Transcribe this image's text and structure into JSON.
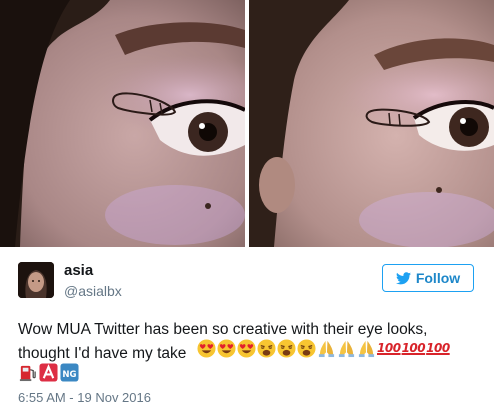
{
  "tweet": {
    "display_name": "asia",
    "handle": "@asialbx",
    "follow_label": "Follow",
    "text": "Wow MUA Twitter has been so creative with their eye looks, thought I'd have my take",
    "emoji_text": "😍😍😍😩😩😩🙏🙏🙏💯💯💯⛽🅰🆖",
    "timestamp": "6:55 AM - 19 Nov 2016"
  },
  "icons": {
    "follow": "twitter-bird-icon",
    "emoji": [
      "heart-eyes",
      "heart-eyes",
      "heart-eyes",
      "weary-face",
      "weary-face",
      "weary-face",
      "folded-hands",
      "folded-hands",
      "folded-hands",
      "hundred-points",
      "hundred-points",
      "hundred-points",
      "fuel-pump",
      "a-button",
      "ng-button"
    ]
  },
  "colors": {
    "accent": "#1da1f2",
    "text": "#14171a",
    "muted": "#657786"
  }
}
